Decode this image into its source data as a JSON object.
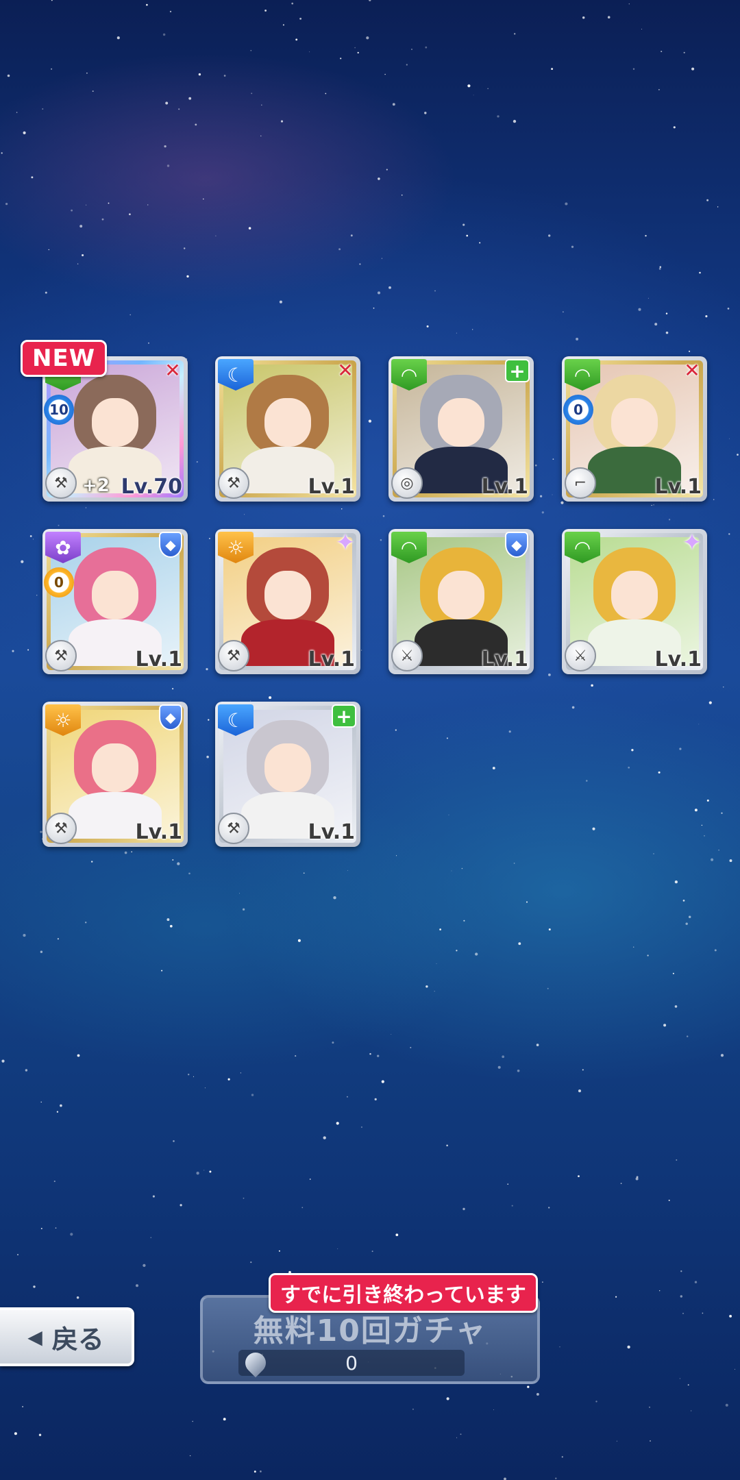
{
  "new_badge": "NEW",
  "cards": [
    {
      "attr": "green",
      "attr_icon": "leaf",
      "role": "attack",
      "weapon": "hammer",
      "level": "Lv.70",
      "plus": "+2",
      "count": "10",
      "count_color": "blue",
      "frame": "rainbow",
      "hair": "#8b6a5a",
      "body": "#f4ecdf",
      "bg": "#caa6d8"
    },
    {
      "attr": "blue",
      "attr_icon": "moon",
      "role": "attack",
      "weapon": "hammer",
      "level": "Lv.1",
      "plus": "",
      "count": "",
      "frame": "gold",
      "hair": "#b07a45",
      "body": "#f2eee7",
      "bg": "#c9c66a"
    },
    {
      "attr": "green",
      "attr_icon": "leaf",
      "role": "heal",
      "weapon": "ring",
      "level": "Lv.1",
      "plus": "",
      "count": "",
      "frame": "gold",
      "hair": "#a6a9b6",
      "body": "#222a44",
      "bg": "#c6b69a"
    },
    {
      "attr": "green",
      "attr_icon": "leaf",
      "role": "attack",
      "weapon": "gun",
      "level": "Lv.1",
      "plus": "",
      "count": "0",
      "count_color": "blue",
      "frame": "gold",
      "hair": "#ecd7a2",
      "body": "#3b6b3d",
      "bg": "#e6c7b4"
    },
    {
      "attr": "purple",
      "attr_icon": "flower",
      "role": "defense",
      "weapon": "hammer",
      "level": "Lv.1",
      "plus": "",
      "count": "0",
      "count_color": "gold",
      "frame": "gold",
      "hair": "#e76f98",
      "body": "#f6f2f6",
      "bg": "#a9d2ea"
    },
    {
      "attr": "orange",
      "attr_icon": "sun",
      "role": "support",
      "weapon": "hammer",
      "level": "Lv.1",
      "plus": "",
      "count": "",
      "frame": "silver",
      "hair": "#b44a3b",
      "body": "#b3242c",
      "bg": "#f2cf84"
    },
    {
      "attr": "green",
      "attr_icon": "leaf",
      "role": "defense",
      "weapon": "sword",
      "level": "Lv.1",
      "plus": "",
      "count": "",
      "frame": "silver",
      "hair": "#e8b43a",
      "body": "#2c2c2c",
      "bg": "#a8c786"
    },
    {
      "attr": "green",
      "attr_icon": "leaf",
      "role": "support",
      "weapon": "sword",
      "level": "Lv.1",
      "plus": "",
      "count": "",
      "frame": "silver",
      "hair": "#e9b73f",
      "body": "#eef4e8",
      "bg": "#b9dc93"
    },
    {
      "attr": "orange",
      "attr_icon": "sun",
      "role": "defense",
      "weapon": "hammer",
      "level": "Lv.1",
      "plus": "",
      "count": "",
      "frame": "gold",
      "hair": "#ea7088",
      "body": "#f5f3f6",
      "bg": "#f0d67a"
    },
    {
      "attr": "blue",
      "attr_icon": "moon",
      "role": "heal",
      "weapon": "hammer",
      "level": "Lv.1",
      "plus": "",
      "count": "",
      "frame": "silver",
      "hair": "#c9c6cf",
      "body": "#f2f2f2",
      "bg": "#d2d6e6"
    }
  ],
  "back_button": {
    "label": "戻る"
  },
  "gacha_button": {
    "label": "無料10回ガチャ",
    "cost": "0",
    "notice": "すでに引き終わっています"
  }
}
